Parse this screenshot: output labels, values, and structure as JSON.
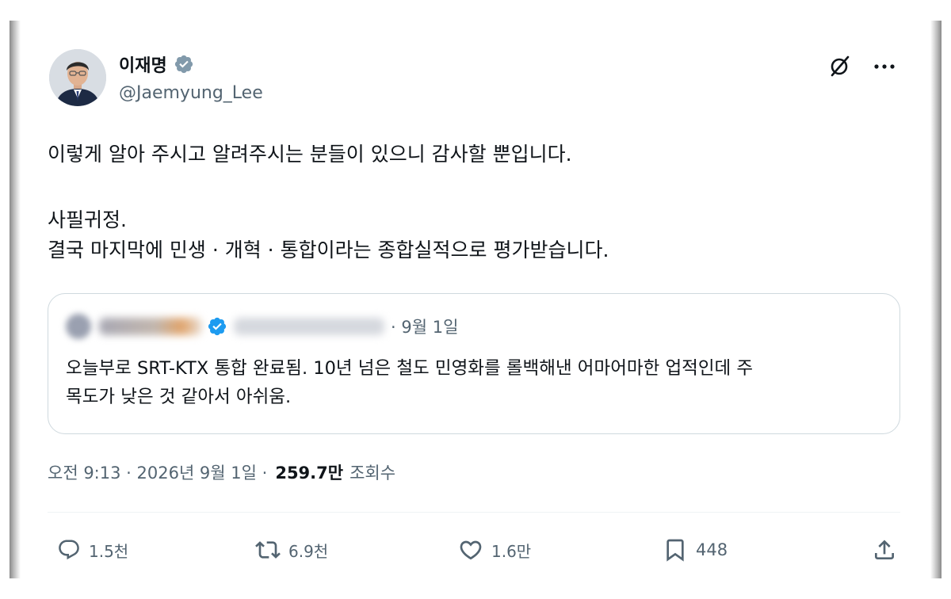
{
  "author": {
    "name": "이재명",
    "handle": "@Jaemyung_Lee"
  },
  "tweet": {
    "lines": [
      "이렇게 알아 주시고 알려주시는 분들이 있으니 감사할 뿐입니다.",
      "사필귀정.",
      "결국 마지막에 민생 · 개혁 · 통합이라는 종합실적으로 평가받습니다."
    ]
  },
  "quote": {
    "date": "· 9월 1일",
    "lines": [
      "오늘부로 SRT-KTX 통합 완료됨. 10년 넘은 철도 민영화를 롤백해낸 어마어마한 업적인데 주",
      "목도가 낮은 것 같아서 아쉬움."
    ]
  },
  "meta": {
    "time_date": "오전 9:13 · 2026년 9월 1일 ·",
    "views_count": "259.7만",
    "views_label": "조회수"
  },
  "actions": {
    "replies": "1.5천",
    "reposts": "6.9천",
    "likes": "1.6만",
    "bookmarks": "448"
  },
  "colors": {
    "verified": "#829aab",
    "quote_verified": "#1d9bf0",
    "secondary_text": "#536471",
    "primary_text": "#0f1419"
  },
  "icons": [
    "grok-icon",
    "more-icon",
    "reply-icon",
    "repost-icon",
    "like-icon",
    "bookmark-icon",
    "share-icon"
  ]
}
